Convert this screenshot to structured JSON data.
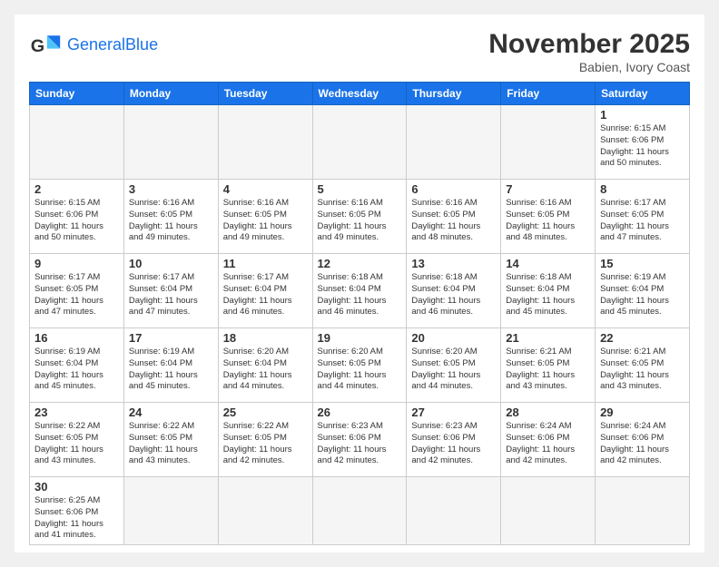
{
  "header": {
    "logo_general": "General",
    "logo_blue": "Blue",
    "month_title": "November 2025",
    "location": "Babien, Ivory Coast"
  },
  "days_of_week": [
    "Sunday",
    "Monday",
    "Tuesday",
    "Wednesday",
    "Thursday",
    "Friday",
    "Saturday"
  ],
  "weeks": [
    [
      {
        "day": "",
        "empty": true
      },
      {
        "day": "",
        "empty": true
      },
      {
        "day": "",
        "empty": true
      },
      {
        "day": "",
        "empty": true
      },
      {
        "day": "",
        "empty": true
      },
      {
        "day": "",
        "empty": true
      },
      {
        "day": "1",
        "sunrise": "6:15 AM",
        "sunset": "6:06 PM",
        "daylight": "11 hours and 50 minutes."
      }
    ],
    [
      {
        "day": "2",
        "sunrise": "6:15 AM",
        "sunset": "6:06 PM",
        "daylight": "11 hours and 50 minutes."
      },
      {
        "day": "3",
        "sunrise": "6:16 AM",
        "sunset": "6:05 PM",
        "daylight": "11 hours and 49 minutes."
      },
      {
        "day": "4",
        "sunrise": "6:16 AM",
        "sunset": "6:05 PM",
        "daylight": "11 hours and 49 minutes."
      },
      {
        "day": "5",
        "sunrise": "6:16 AM",
        "sunset": "6:05 PM",
        "daylight": "11 hours and 49 minutes."
      },
      {
        "day": "6",
        "sunrise": "6:16 AM",
        "sunset": "6:05 PM",
        "daylight": "11 hours and 48 minutes."
      },
      {
        "day": "7",
        "sunrise": "6:16 AM",
        "sunset": "6:05 PM",
        "daylight": "11 hours and 48 minutes."
      },
      {
        "day": "8",
        "sunrise": "6:17 AM",
        "sunset": "6:05 PM",
        "daylight": "11 hours and 47 minutes."
      }
    ],
    [
      {
        "day": "9",
        "sunrise": "6:17 AM",
        "sunset": "6:05 PM",
        "daylight": "11 hours and 47 minutes."
      },
      {
        "day": "10",
        "sunrise": "6:17 AM",
        "sunset": "6:04 PM",
        "daylight": "11 hours and 47 minutes."
      },
      {
        "day": "11",
        "sunrise": "6:17 AM",
        "sunset": "6:04 PM",
        "daylight": "11 hours and 46 minutes."
      },
      {
        "day": "12",
        "sunrise": "6:18 AM",
        "sunset": "6:04 PM",
        "daylight": "11 hours and 46 minutes."
      },
      {
        "day": "13",
        "sunrise": "6:18 AM",
        "sunset": "6:04 PM",
        "daylight": "11 hours and 46 minutes."
      },
      {
        "day": "14",
        "sunrise": "6:18 AM",
        "sunset": "6:04 PM",
        "daylight": "11 hours and 45 minutes."
      },
      {
        "day": "15",
        "sunrise": "6:19 AM",
        "sunset": "6:04 PM",
        "daylight": "11 hours and 45 minutes."
      }
    ],
    [
      {
        "day": "16",
        "sunrise": "6:19 AM",
        "sunset": "6:04 PM",
        "daylight": "11 hours and 45 minutes."
      },
      {
        "day": "17",
        "sunrise": "6:19 AM",
        "sunset": "6:04 PM",
        "daylight": "11 hours and 45 minutes."
      },
      {
        "day": "18",
        "sunrise": "6:20 AM",
        "sunset": "6:04 PM",
        "daylight": "11 hours and 44 minutes."
      },
      {
        "day": "19",
        "sunrise": "6:20 AM",
        "sunset": "6:05 PM",
        "daylight": "11 hours and 44 minutes."
      },
      {
        "day": "20",
        "sunrise": "6:20 AM",
        "sunset": "6:05 PM",
        "daylight": "11 hours and 44 minutes."
      },
      {
        "day": "21",
        "sunrise": "6:21 AM",
        "sunset": "6:05 PM",
        "daylight": "11 hours and 43 minutes."
      },
      {
        "day": "22",
        "sunrise": "6:21 AM",
        "sunset": "6:05 PM",
        "daylight": "11 hours and 43 minutes."
      }
    ],
    [
      {
        "day": "23",
        "sunrise": "6:22 AM",
        "sunset": "6:05 PM",
        "daylight": "11 hours and 43 minutes."
      },
      {
        "day": "24",
        "sunrise": "6:22 AM",
        "sunset": "6:05 PM",
        "daylight": "11 hours and 43 minutes."
      },
      {
        "day": "25",
        "sunrise": "6:22 AM",
        "sunset": "6:05 PM",
        "daylight": "11 hours and 42 minutes."
      },
      {
        "day": "26",
        "sunrise": "6:23 AM",
        "sunset": "6:06 PM",
        "daylight": "11 hours and 42 minutes."
      },
      {
        "day": "27",
        "sunrise": "6:23 AM",
        "sunset": "6:06 PM",
        "daylight": "11 hours and 42 minutes."
      },
      {
        "day": "28",
        "sunrise": "6:24 AM",
        "sunset": "6:06 PM",
        "daylight": "11 hours and 42 minutes."
      },
      {
        "day": "29",
        "sunrise": "6:24 AM",
        "sunset": "6:06 PM",
        "daylight": "11 hours and 42 minutes."
      }
    ],
    [
      {
        "day": "30",
        "sunrise": "6:25 AM",
        "sunset": "6:06 PM",
        "daylight": "11 hours and 41 minutes."
      },
      {
        "day": "",
        "empty": true
      },
      {
        "day": "",
        "empty": true
      },
      {
        "day": "",
        "empty": true
      },
      {
        "day": "",
        "empty": true
      },
      {
        "day": "",
        "empty": true
      },
      {
        "day": "",
        "empty": true
      }
    ]
  ]
}
